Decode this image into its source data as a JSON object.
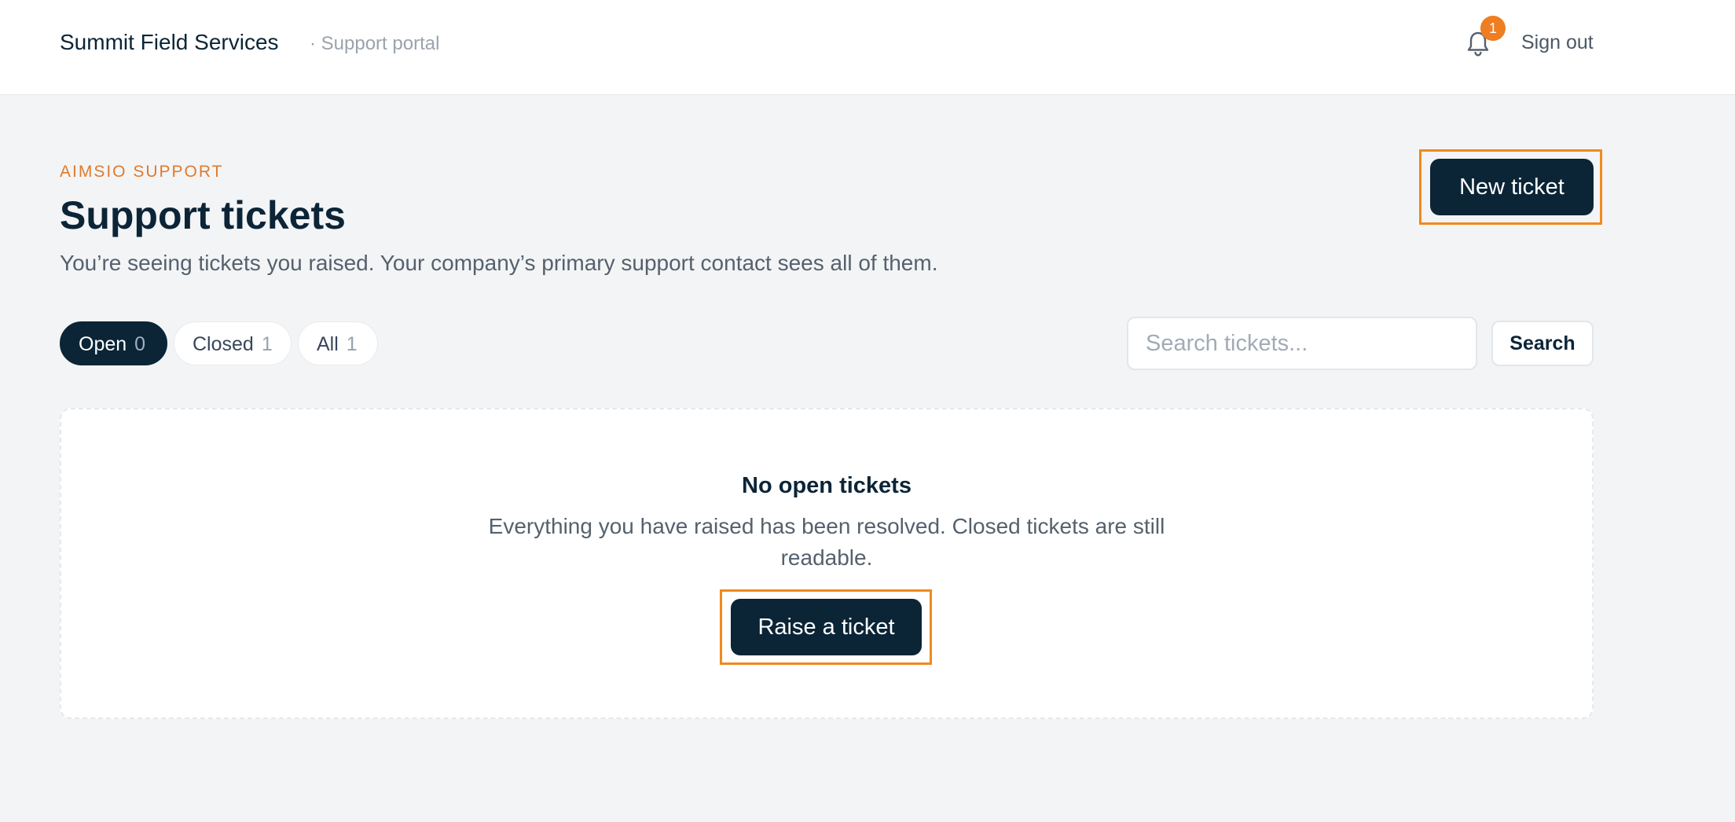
{
  "header": {
    "brand": "Summit Field Services",
    "brand_sub": "· Support portal",
    "notification_count": "1",
    "sign_out": "Sign out"
  },
  "page": {
    "eyebrow": "AIMSIO SUPPORT",
    "title": "Support tickets",
    "subtitle": "You’re seeing tickets you raised. Your company’s primary support contact sees all of them.",
    "new_ticket_label": "New ticket"
  },
  "tabs": [
    {
      "label": "Open",
      "count": "0",
      "active": true
    },
    {
      "label": "Closed",
      "count": "1",
      "active": false
    },
    {
      "label": "All",
      "count": "1",
      "active": false
    }
  ],
  "search": {
    "placeholder": "Search tickets...",
    "value": "",
    "button_label": "Search"
  },
  "empty_state": {
    "title": "No open tickets",
    "text": "Everything you have raised has been resolved. Closed tickets are still readable.",
    "button_label": "Raise a ticket"
  },
  "colors": {
    "primary": "#0b2537",
    "accent": "#ef7d22",
    "focus_ring": "#f08a1c",
    "background": "#f3f4f6"
  },
  "icons": {
    "notifications": "bell-icon"
  }
}
